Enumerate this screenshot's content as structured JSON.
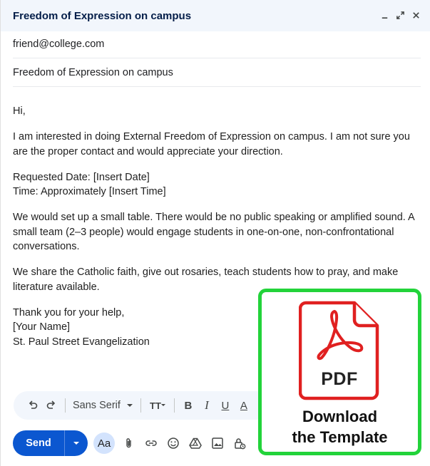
{
  "window": {
    "title": "Freedom of Expression on campus",
    "controls": [
      "minimize-icon",
      "expand-icon",
      "close-icon"
    ]
  },
  "fields": {
    "to": "friend@college.com",
    "subject": "Freedom of Expression on campus"
  },
  "body": {
    "greeting": "Hi,",
    "para1": "I am interested in doing External Freedom of Expression on campus. I am not sure you are the proper contact and would appreciate your direction.",
    "date_line": "Requested Date: [Insert Date]",
    "time_line": "Time: Approximately [Insert Time]",
    "para2": "We would set up a small table. There would be no public speaking or amplified sound. A small team (2–3 people) would engage students in one-on-one, non-confrontational conversations.",
    "para3": "We share the Catholic faith, give out rosaries, teach students how to pray, and make literature available.",
    "closing": "Thank you for your help,",
    "name": "[Your Name]",
    "org": "St. Paul Street Evangelization"
  },
  "format_toolbar": {
    "font": "Sans Serif",
    "icons": [
      "undo-icon",
      "redo-icon",
      "font-size-icon",
      "bold-icon",
      "italic-icon",
      "underline-icon",
      "text-color-icon"
    ]
  },
  "bottom_toolbar": {
    "send_label": "Send",
    "format_label": "Aa",
    "icons": [
      "attach-icon",
      "link-icon",
      "emoji-icon",
      "drive-icon",
      "photo-icon",
      "lock-clock-icon"
    ]
  },
  "overlay": {
    "file_type": "PDF",
    "caption_line1": "Download",
    "caption_line2": "the Template",
    "border_color": "#22d33a",
    "accent_color": "#e02020"
  },
  "colors": {
    "header_bg": "#f2f6fc",
    "title_color": "#041e49",
    "send_bg": "#0b57d0"
  }
}
